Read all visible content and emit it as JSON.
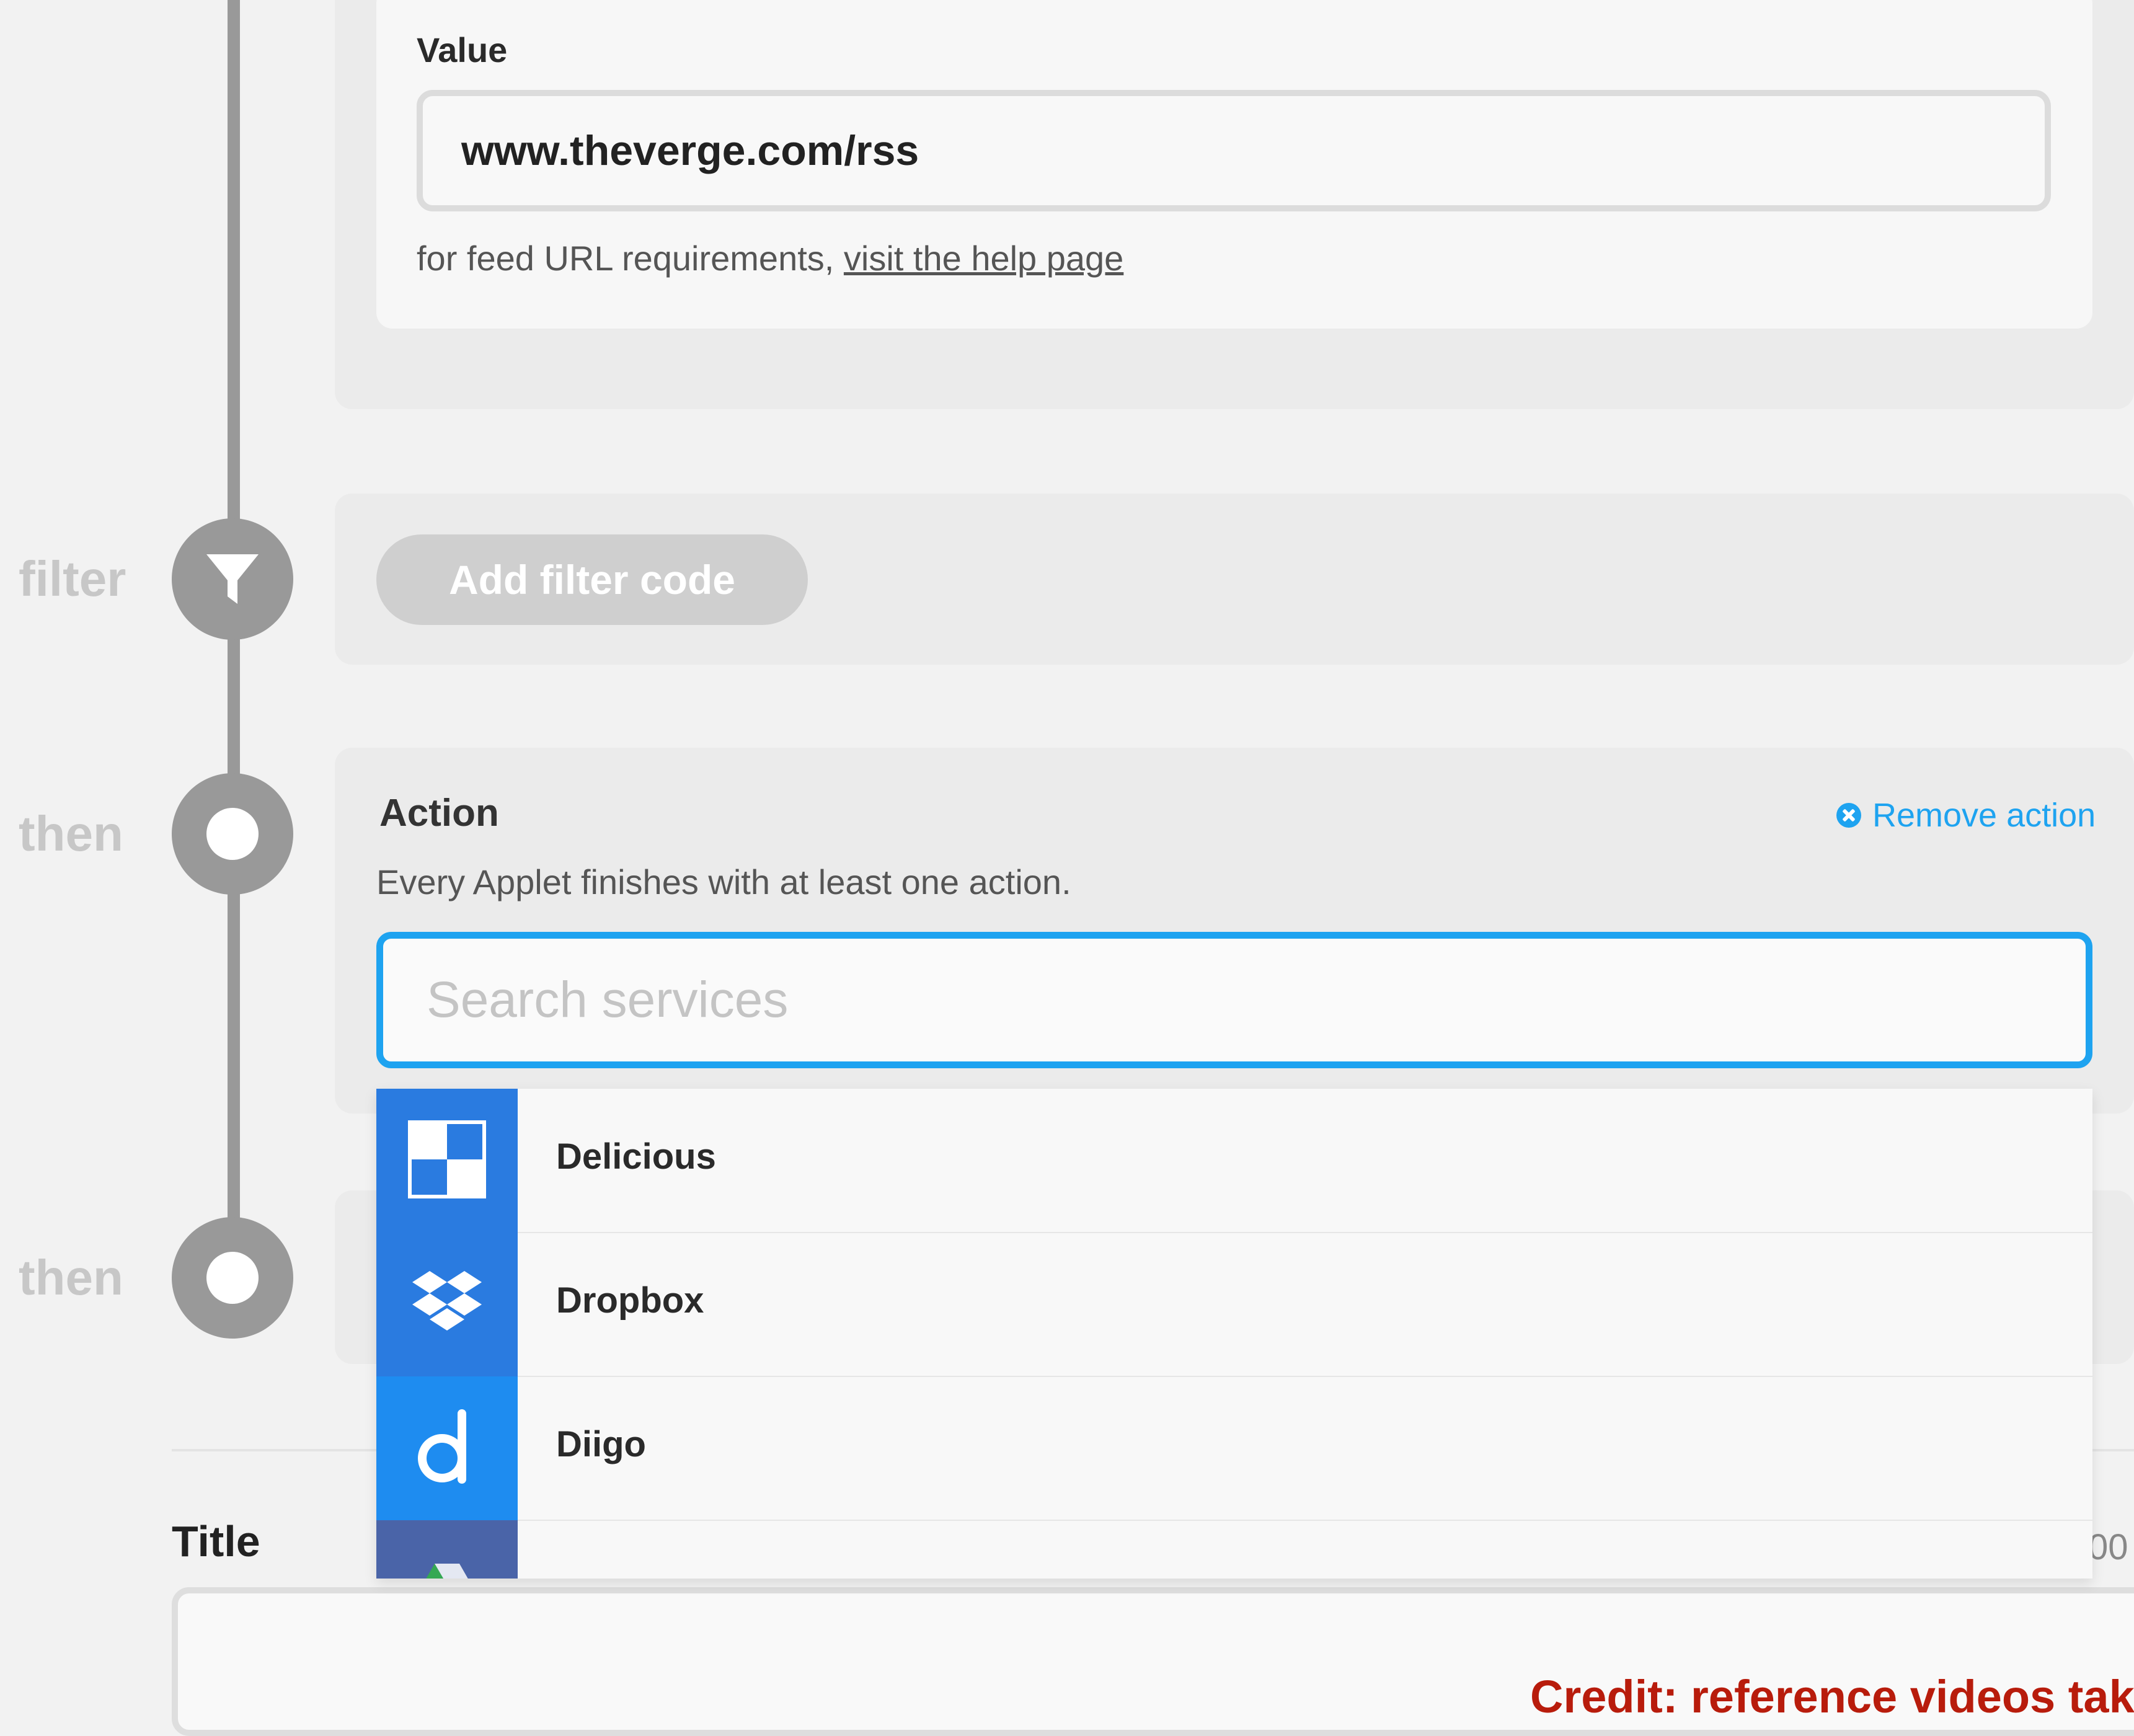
{
  "trigger": {
    "value_label": "Value",
    "value_input": "www.theverge.com/rss",
    "help_prefix": "for feed URL requirements, ",
    "help_link": "visit the help page"
  },
  "steps": {
    "filter_label": "filter",
    "then_label_1": "then",
    "then_label_2": "then"
  },
  "filter": {
    "add_button": "Add filter code"
  },
  "action": {
    "title": "Action",
    "remove": "Remove action",
    "subtitle": "Every Applet finishes with at least one action.",
    "search_placeholder": "Search services",
    "accent_color": "#1ea3f0"
  },
  "services": [
    {
      "name": "Delicious",
      "icon": "delicious-icon",
      "color": "#2a7be0"
    },
    {
      "name": "Dropbox",
      "icon": "dropbox-icon",
      "color": "#2a7be0"
    },
    {
      "name": "Diigo",
      "icon": "diigo-icon",
      "color": "#1e8cf0"
    },
    {
      "name": "",
      "icon": "google-drive-icon",
      "color": "#4a64a8"
    }
  ],
  "form": {
    "title_label": "Title",
    "counter_partial": "00"
  },
  "watermark": "Credit: reference videos take"
}
